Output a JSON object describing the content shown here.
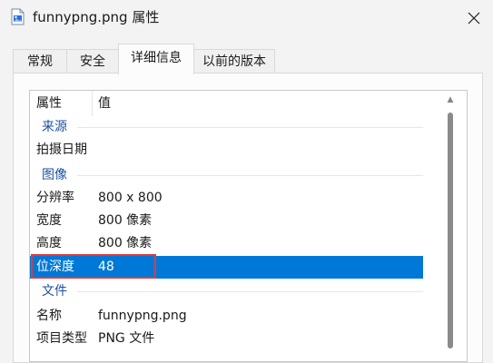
{
  "window": {
    "title": "funnypng.png 属性"
  },
  "tabs": [
    {
      "label": "常规",
      "active": false
    },
    {
      "label": "安全",
      "active": false
    },
    {
      "label": "详细信息",
      "active": true
    },
    {
      "label": "以前的版本",
      "active": false
    }
  ],
  "columns": {
    "property": "属性",
    "value": "值"
  },
  "groups": {
    "source": "来源",
    "image": "图像",
    "file": "文件"
  },
  "rows": {
    "date_taken": {
      "name": "拍摄日期",
      "value": ""
    },
    "dimensions": {
      "name": "分辨率",
      "value": "800 x 800"
    },
    "width": {
      "name": "宽度",
      "value": "800 像素"
    },
    "height": {
      "name": "高度",
      "value": "800 像素"
    },
    "bit_depth": {
      "name": "位深度",
      "value": "48",
      "selected": true
    },
    "filename": {
      "name": "名称",
      "value": "funnypng.png"
    },
    "item_type": {
      "name": "项目类型",
      "value": "PNG 文件"
    }
  },
  "colors": {
    "selection": "#0078d7",
    "group_label": "#1e50a0",
    "highlight_border": "#e53935"
  },
  "icons": {
    "app": "png-file-icon",
    "close": "close-icon"
  }
}
